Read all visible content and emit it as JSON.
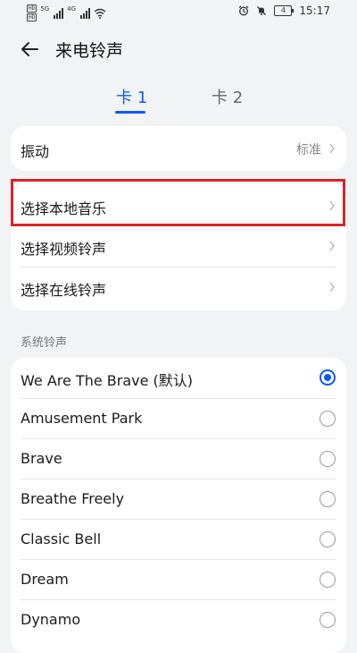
{
  "status_bar": {
    "sim1": "HD",
    "sim1_sub": "1",
    "net1": "5G",
    "net2": "4G",
    "battery": "4",
    "time": "15:17"
  },
  "header": {
    "title": "来电铃声"
  },
  "tabs": [
    {
      "label": "卡 1",
      "active": true
    },
    {
      "label": "卡 2",
      "active": false
    }
  ],
  "vibration": {
    "label": "振动",
    "value": "标准"
  },
  "sources": [
    {
      "label": "选择本地音乐"
    },
    {
      "label": "选择视频铃声"
    },
    {
      "label": "选择在线铃声"
    }
  ],
  "system_section": {
    "title": "系统铃声"
  },
  "ringtones": [
    {
      "label": "We Are The Brave (默认)",
      "selected": true
    },
    {
      "label": "Amusement Park",
      "selected": false
    },
    {
      "label": "Brave",
      "selected": false
    },
    {
      "label": "Breathe Freely",
      "selected": false
    },
    {
      "label": "Classic Bell",
      "selected": false
    },
    {
      "label": "Dream",
      "selected": false
    },
    {
      "label": "Dynamo",
      "selected": false
    }
  ],
  "colors": {
    "accent": "#0a59f7",
    "highlight_box": "#d8232a"
  }
}
